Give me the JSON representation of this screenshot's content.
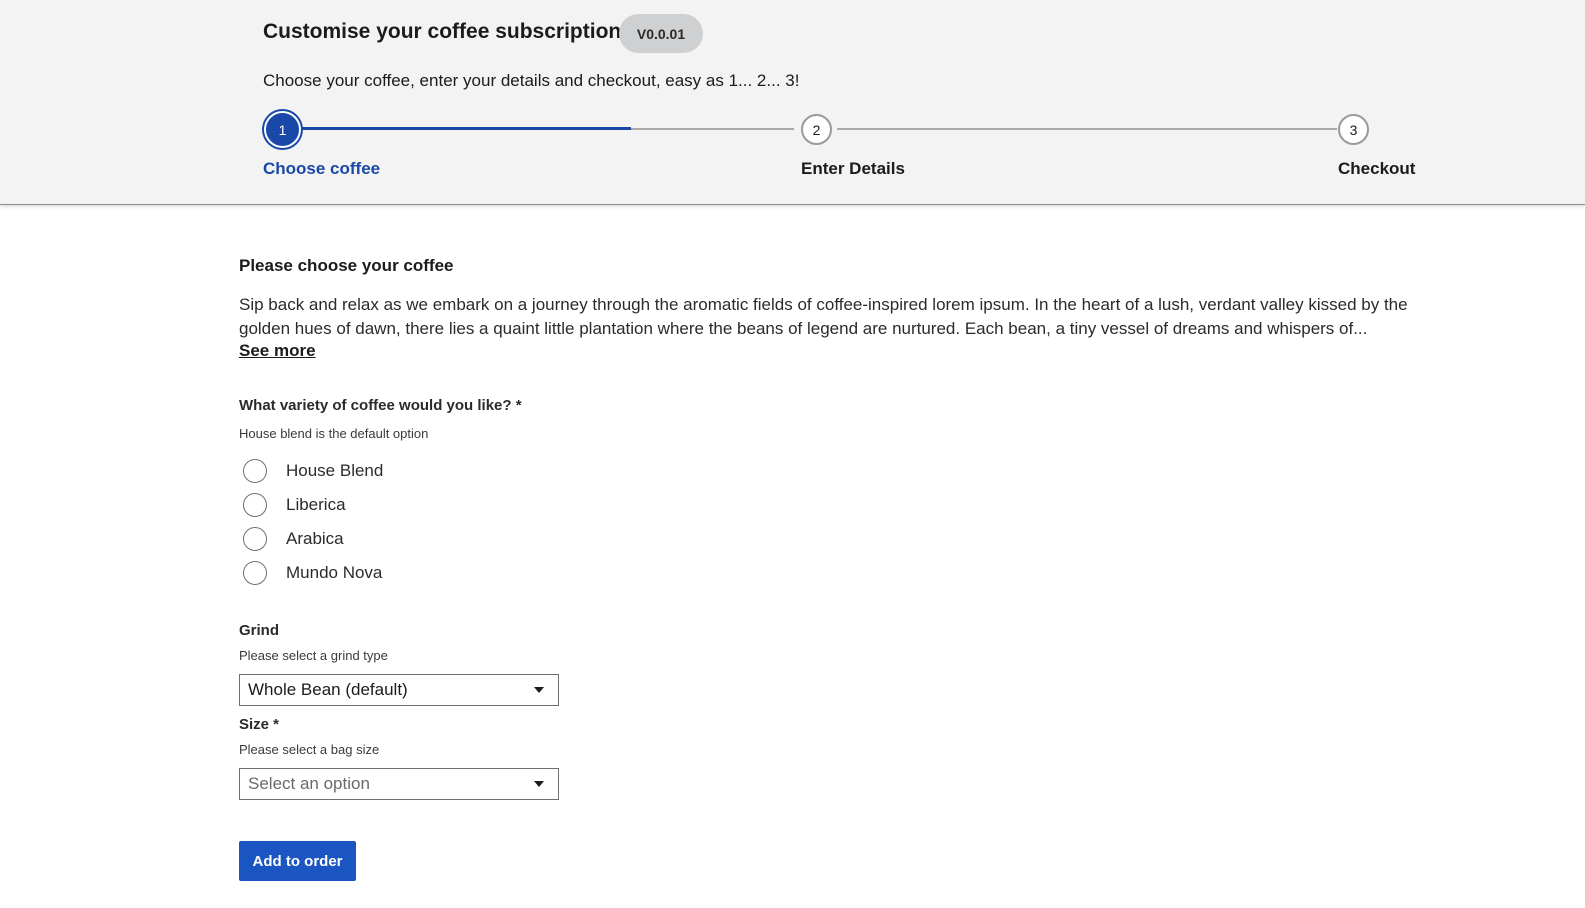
{
  "header": {
    "title": "Customise your coffee subscription",
    "version": "V0.0.01",
    "subtitle": "Choose your coffee, enter your details and checkout, easy as 1... 2... 3!"
  },
  "stepper": {
    "progress_fraction_of_first_segment": 0.67,
    "steps": [
      {
        "number": "1",
        "label": "Choose coffee",
        "state": "active"
      },
      {
        "number": "2",
        "label": "Enter Details",
        "state": "upcoming"
      },
      {
        "number": "3",
        "label": "Checkout",
        "state": "upcoming"
      }
    ]
  },
  "main": {
    "heading": "Please choose your coffee",
    "intro": "Sip back and relax as we embark on a journey through the aromatic fields of coffee-inspired lorem ipsum. In the heart of a lush, verdant valley kissed by the golden hues of dawn, there lies a quaint little plantation where the beans of legend are nurtured. Each bean, a tiny vessel of dreams and whispers of...",
    "see_more": "See more",
    "variety": {
      "label": "What variety of coffee would you like? *",
      "hint": "House blend is the default option",
      "options": [
        "House Blend",
        "Liberica",
        "Arabica",
        "Mundo Nova"
      ]
    },
    "grind": {
      "label": "Grind",
      "hint": "Please select a grind type",
      "value": "Whole Bean (default)"
    },
    "size": {
      "label": "Size *",
      "hint": "Please select a bag size",
      "placeholder": "Select an option"
    },
    "submit_label": "Add to order"
  },
  "colors": {
    "accent": "#1a48a8",
    "button": "#1a55c2",
    "header_bg": "#f3f3f3"
  }
}
